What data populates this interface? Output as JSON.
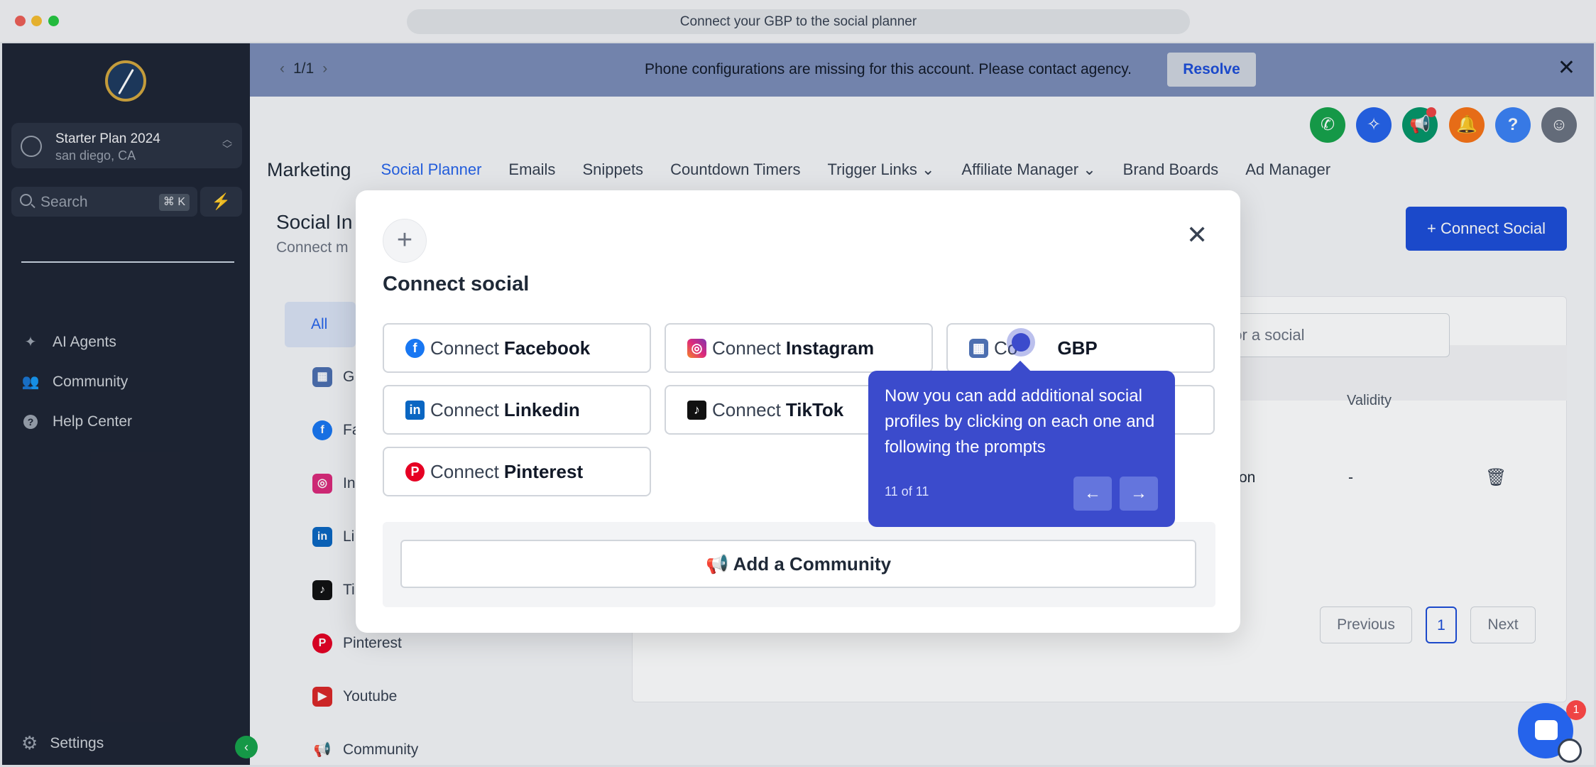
{
  "window": {
    "url_title": "Connect your GBP to the social planner"
  },
  "sidebar": {
    "account": {
      "name": "Starter Plan 2024",
      "location": "san diego, CA"
    },
    "search": {
      "placeholder": "Search",
      "shortcut": "⌘ K"
    },
    "items": [
      {
        "label": "AI Agents",
        "icon": "sparkles-icon"
      },
      {
        "label": "Community",
        "icon": "users-icon"
      },
      {
        "label": "Help Center",
        "icon": "help-icon"
      }
    ],
    "settings_label": "Settings"
  },
  "banner": {
    "pager": "1/1",
    "message": "Phone configurations are missing for this account. Please contact agency.",
    "resolve_label": "Resolve"
  },
  "topnav": {
    "brand": "Marketing",
    "tabs": [
      "Social Planner",
      "Emails",
      "Snippets",
      "Countdown Timers",
      "Trigger Links",
      "Affiliate Manager",
      "Brand Boards",
      "Ad Manager"
    ],
    "active_tab": "Social Planner"
  },
  "page": {
    "title": "Social In",
    "subtitle": "Connect m",
    "connect_social_label": "+ Connect Social",
    "filters": [
      "All",
      "GI",
      "Fa",
      "In",
      "Li",
      "Ti",
      "Pinterest",
      "Youtube",
      "Community"
    ],
    "search_placeholder": "earch for a social",
    "column_validity": "Validity",
    "row": {
      "status_fragment": "on",
      "validity": "-"
    },
    "pagination": {
      "previous": "Previous",
      "page": "1",
      "next": "Next"
    }
  },
  "modal": {
    "title": "Connect social",
    "buttons": [
      {
        "prefix": "Connect",
        "name": "Facebook"
      },
      {
        "prefix": "Connect",
        "name": "Instagram"
      },
      {
        "prefix": "Co",
        "name": "GBP",
        "suffix_hidden": "nect"
      },
      {
        "prefix": "Connect",
        "name": "Linkedin"
      },
      {
        "prefix": "Connect",
        "name": "TikTok"
      },
      {
        "prefix": "Connect",
        "name": "Pinterest"
      }
    ],
    "add_community_label": "Add a Community"
  },
  "tooltip": {
    "text": "Now you can add additional social profiles by clicking on each one and following the prompts",
    "step": "11 of 11"
  },
  "chat": {
    "badge": "1"
  },
  "colors": {
    "primary": "#1d4ed8",
    "tooltip": "#3b4bcc",
    "sidebar": "#1e2433"
  }
}
